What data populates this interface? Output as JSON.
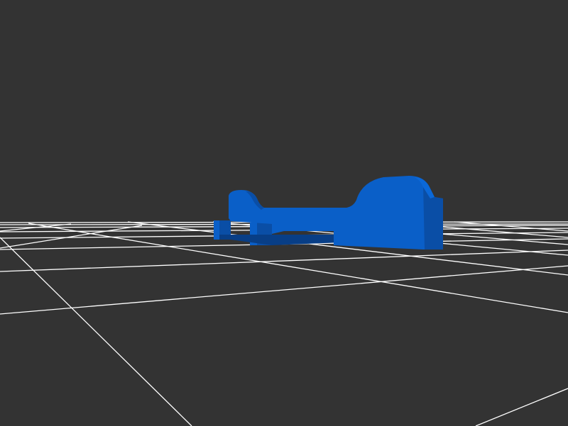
{
  "scene": {
    "background_color": "#333333",
    "grid_color": "#ffffff",
    "model_color": "#0a5fc8",
    "model_shade_color": "#0a4ea6",
    "model_dark_color": "#083e86"
  }
}
